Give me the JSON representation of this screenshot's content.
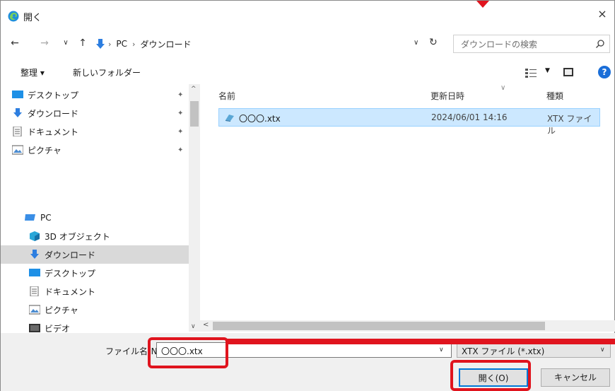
{
  "window": {
    "title": "開く",
    "close": "×"
  },
  "nav": {
    "back": "←",
    "forward": "→",
    "recent": "∨",
    "up": "↑",
    "breadcrumb": [
      "PC",
      "ダウンロード"
    ],
    "breadcrumb_sep": "›",
    "search_placeholder": "ダウンロードの検索"
  },
  "toolbar": {
    "organize": "整理 ▾",
    "new_folder": "新しいフォルダー"
  },
  "sidebar": {
    "quick_access": [
      {
        "label": "デスクトップ",
        "icon": "desktop-icon",
        "pinned": true
      },
      {
        "label": "ダウンロード",
        "icon": "download-icon",
        "pinned": true
      },
      {
        "label": "ドキュメント",
        "icon": "document-icon",
        "pinned": true
      },
      {
        "label": "ピクチャ",
        "icon": "pictures-icon",
        "pinned": true
      }
    ],
    "pc": {
      "label": "PC",
      "icon": "pc-icon"
    },
    "pc_items": [
      {
        "label": "3D オブジェクト",
        "icon": "3d-objects-icon"
      },
      {
        "label": "ダウンロード",
        "icon": "download-icon",
        "selected": true
      },
      {
        "label": "デスクトップ",
        "icon": "desktop-icon"
      },
      {
        "label": "ドキュメント",
        "icon": "document-icon"
      },
      {
        "label": "ピクチャ",
        "icon": "pictures-icon"
      },
      {
        "label": "ビデオ",
        "icon": "video-icon"
      }
    ],
    "pin_glyph": "✦"
  },
  "filelist": {
    "columns": [
      "名前",
      "更新日時",
      "種類"
    ],
    "rows": [
      {
        "name": "〇〇〇.xtx",
        "modified": "2024/06/01 14:16",
        "type": "XTX ファイル",
        "selected": true
      }
    ]
  },
  "footer": {
    "filename_label": "ファイル名(N):",
    "filename_value": "〇〇〇.xtx",
    "filter_value": "XTX ファイル (*.xtx)",
    "open_button": "開く(O)",
    "cancel_button": "キャンセル"
  },
  "colors": {
    "highlight": "#e0141e",
    "selection": "#cce8ff",
    "accent": "#0078d7"
  }
}
